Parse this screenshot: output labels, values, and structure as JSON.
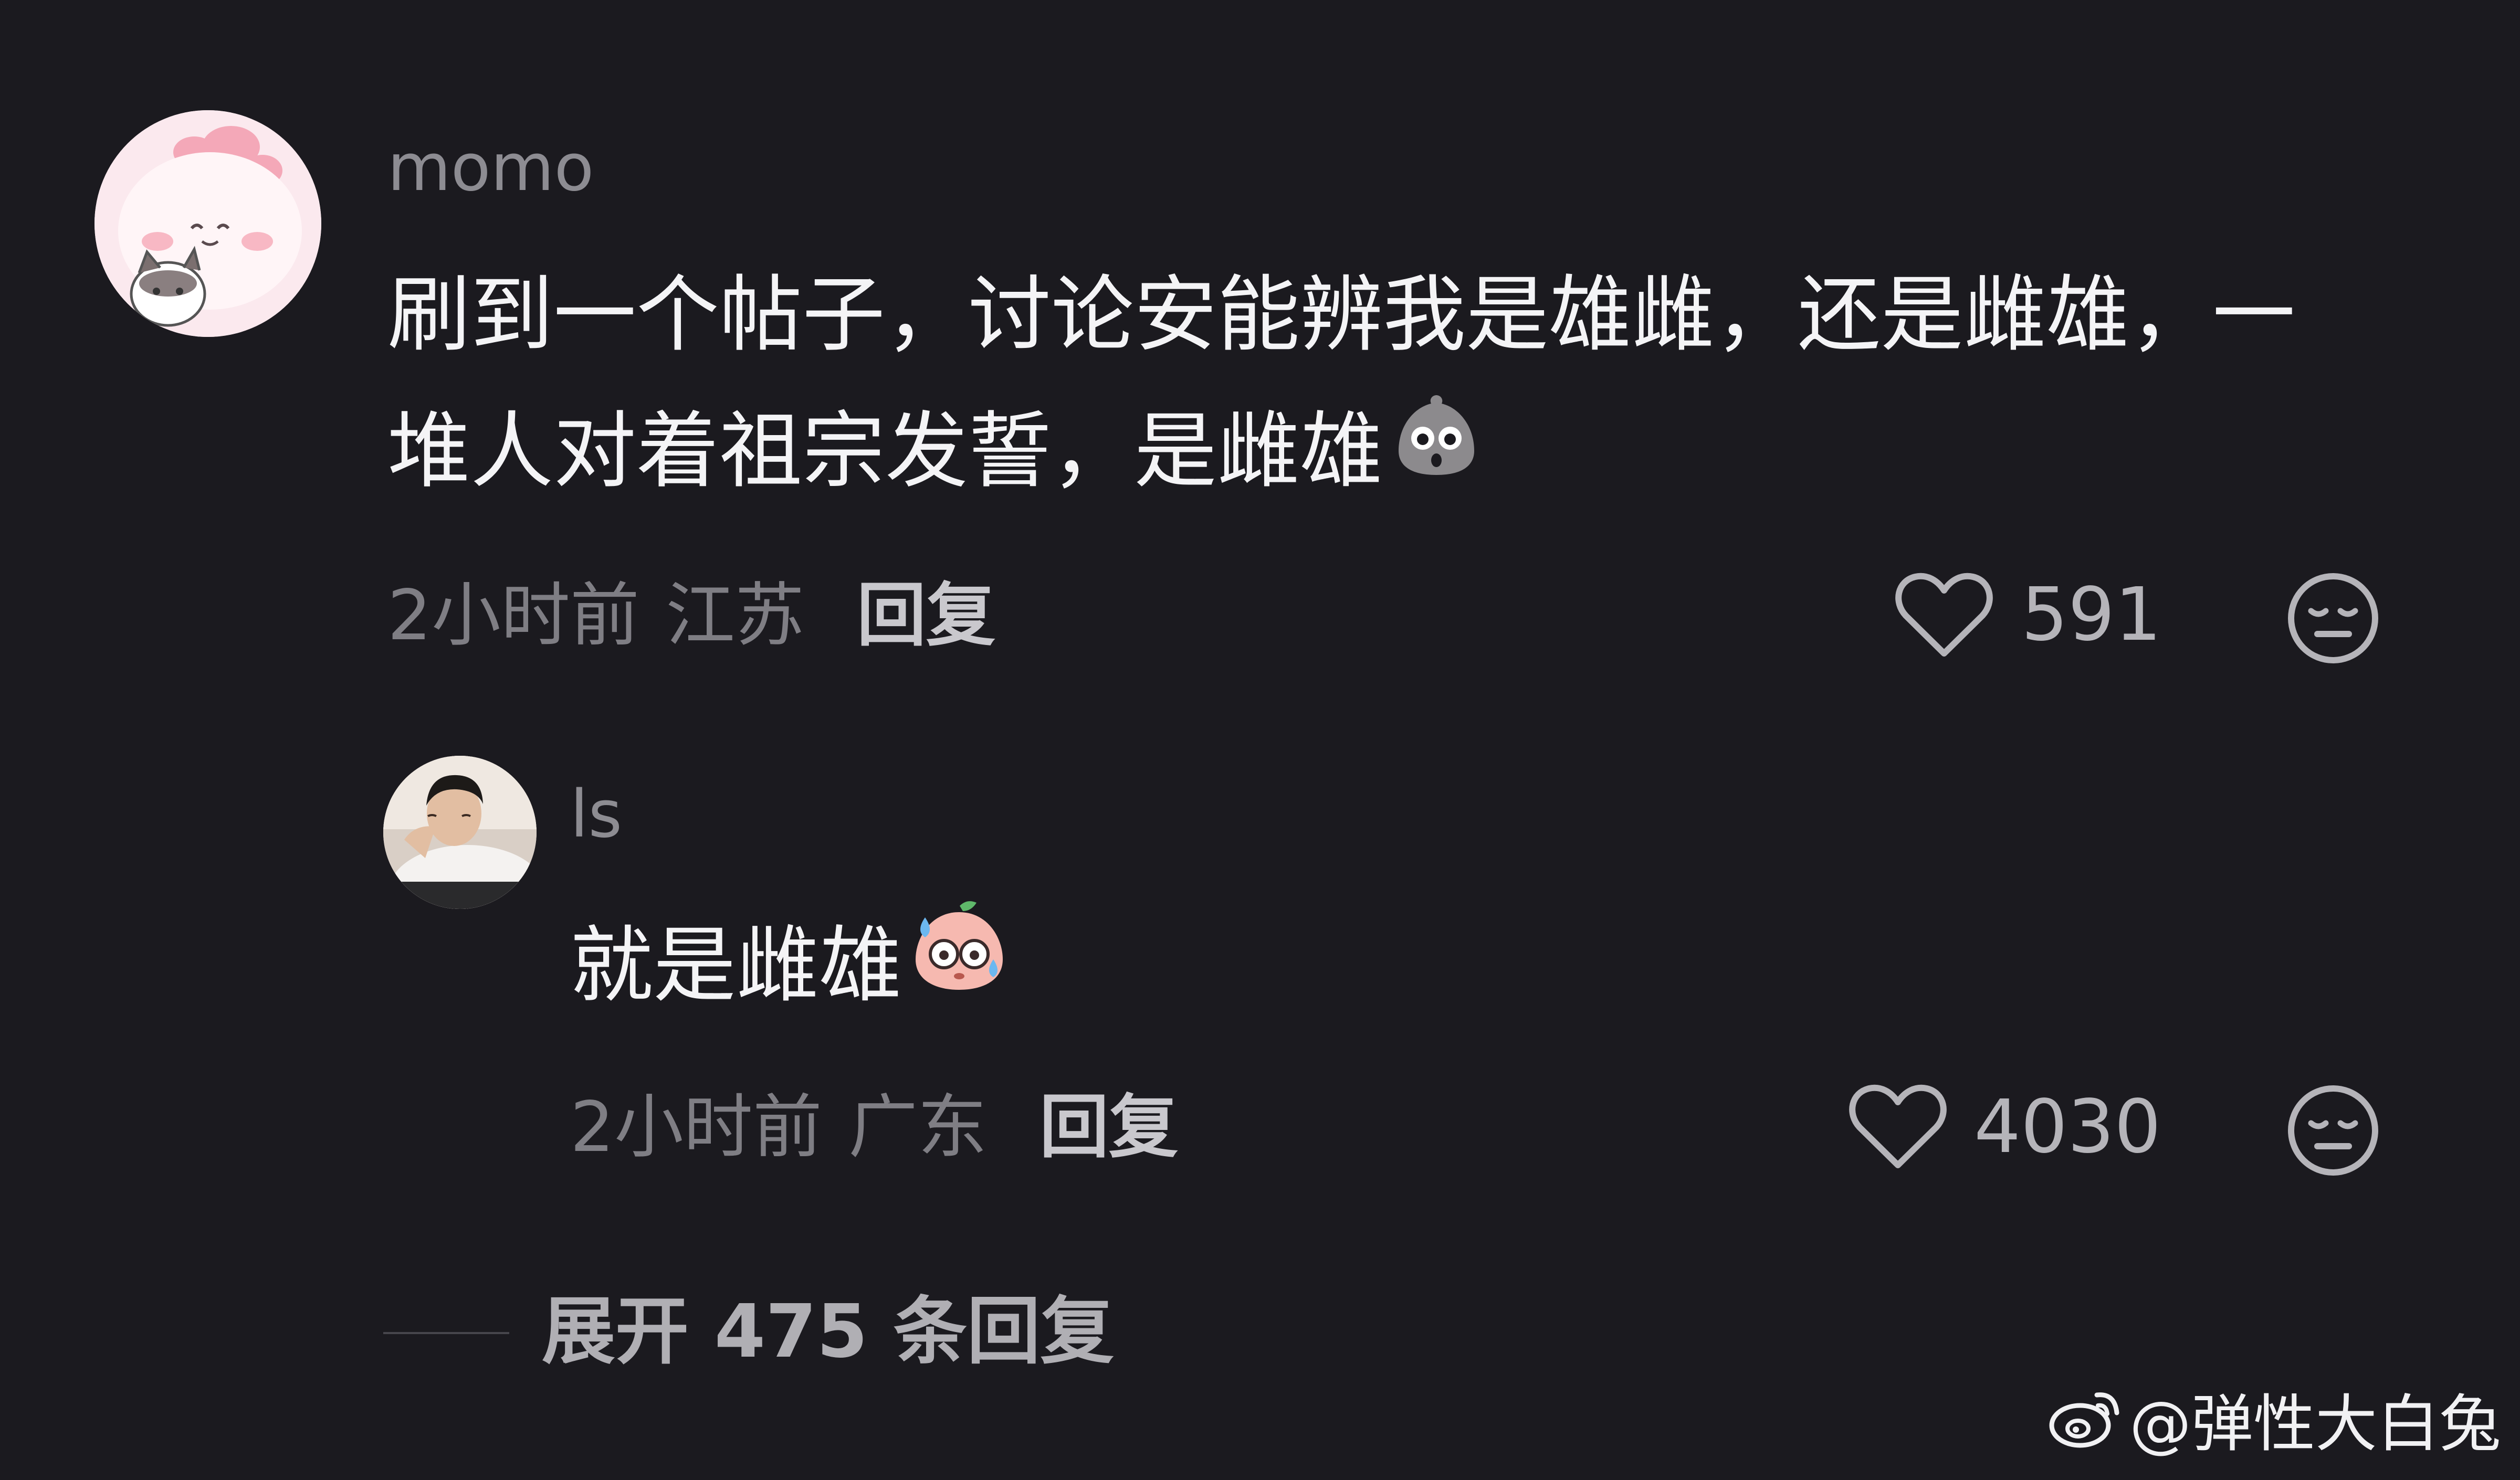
{
  "colors": {
    "background": "#1b1a1f",
    "username": "#8d8c92",
    "comment_text": "#f4f4f6",
    "meta_text": "#7f7e84",
    "reply_label": "#c9c8cd",
    "icon_stroke": "#b5b4b9"
  },
  "comments": [
    {
      "username": "momo",
      "avatar_icon": "pink-bunny-cat-avatar",
      "text_line1": "刷到一个帖子，讨论安能辨我是雄雌，还是雌雄，一",
      "text_line2": "堆人对着祖宗发誓，是雌雄",
      "emoji_icon": "gray-shocked-blob-emoji",
      "time": "2小时前",
      "location": "江苏",
      "reply_label": "回复",
      "likes": "591",
      "like_icon": "heart-outline-icon",
      "dislike_icon": "meh-face-icon"
    },
    {
      "username": "ls",
      "avatar_icon": "person-photo-avatar",
      "text": "就是雌雄",
      "emoji_icon": "sweating-peach-emoji",
      "time": "2小时前",
      "location": "广东",
      "reply_label": "回复",
      "likes": "4030",
      "like_icon": "heart-outline-icon",
      "dislike_icon": "meh-face-icon"
    }
  ],
  "expand_replies": "展开 475 条回复",
  "watermark": {
    "logo_icon": "weibo-logo-icon",
    "text": "@弹性大白兔"
  }
}
